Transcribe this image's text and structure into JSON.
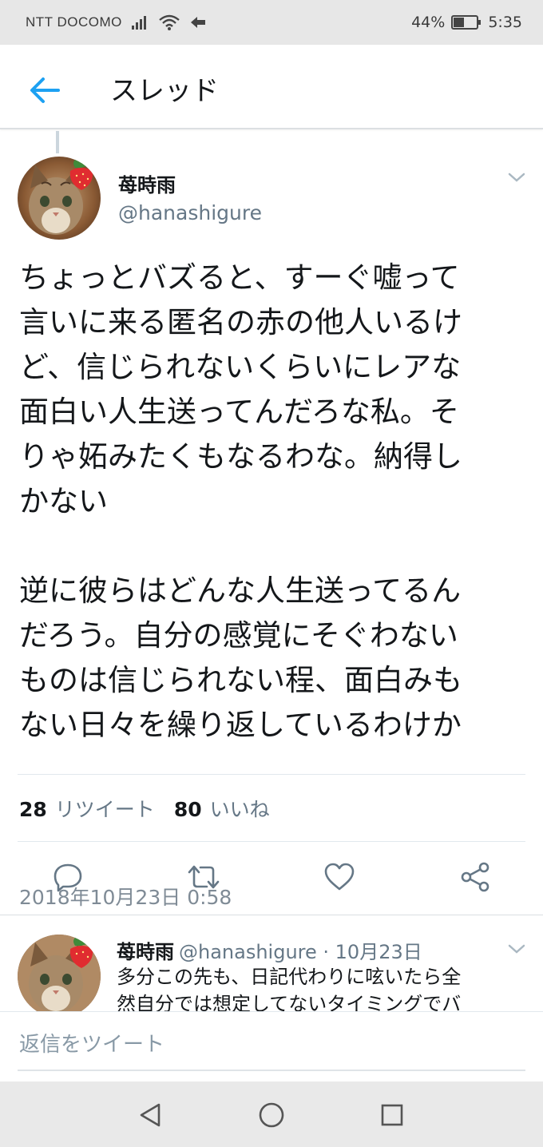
{
  "status_bar": {
    "carrier": "NTT DOCOMO",
    "battery": "44%",
    "time": "5:35"
  },
  "header": {
    "title": "スレッド"
  },
  "tweet": {
    "display_name": "苺時雨",
    "handle": "@hanashigure",
    "paragraph1": [
      "ちょっとバズると、すーぐ嘘って",
      "言いに来る匿名の赤の他人いるけ",
      "ど、信じられないくらいにレアな",
      "面白い人生送ってんだろな私。そ",
      "りゃ妬みたくもなるわな。納得し",
      "かない"
    ],
    "paragraph2": [
      "逆に彼らはどんな人生送ってるん",
      "だろう。自分の感覚にそぐわない",
      "ものは信じられない程、面白みも",
      "ない日々を繰り返しているわけか"
    ],
    "timestamp": "2018年10月23日 0:58",
    "retweet_count": "28",
    "retweet_label": "リツイート",
    "like_count": "80",
    "like_label": "いいね"
  },
  "reply": {
    "display_name": "苺時雨",
    "meta": "@hanashigure · 10月23日",
    "text_lines": [
      "多分この先も、日記代わりに呟いたら全",
      "然自分では想定してないタイミングでバ"
    ]
  },
  "compose": {
    "placeholder": "返信をツイート"
  },
  "colors": {
    "accent": "#1da1f2",
    "secondary_text": "#657786",
    "icon_gray": "#657786",
    "status_bar_bg": "#e7e7e7",
    "nav_bar_bg": "#e9e9e9"
  },
  "icons": {
    "back": "arrow-left-icon",
    "reply": "reply-icon",
    "retweet": "retweet-icon",
    "like": "heart-icon",
    "share": "share-icon",
    "more": "chevron-down-icon",
    "nav_back": "triangle-back-icon",
    "nav_home": "circle-home-icon",
    "nav_recents": "square-recents-icon"
  }
}
